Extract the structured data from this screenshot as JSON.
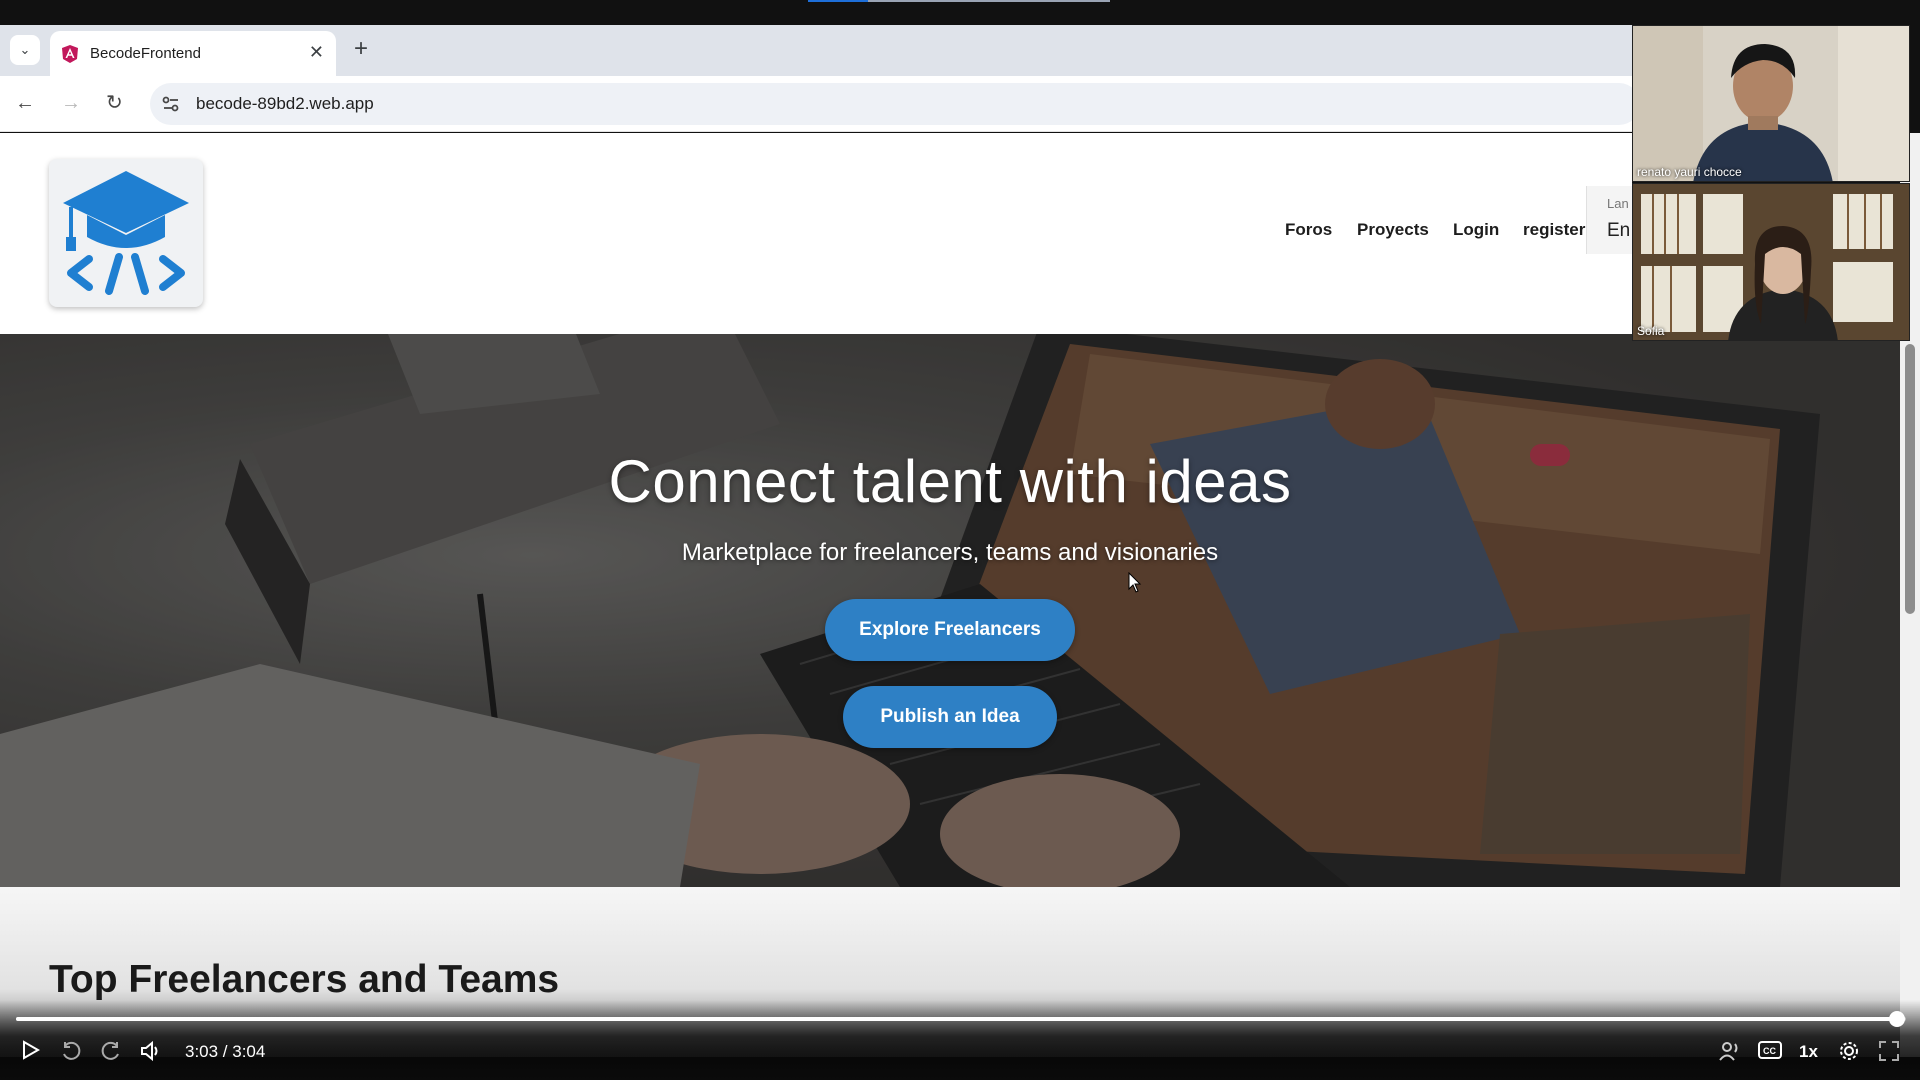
{
  "browser": {
    "tab_title": "BecodeFrontend",
    "url": "becode-89bd2.web.app"
  },
  "site": {
    "nav": {
      "foros": "Foros",
      "proyects": "Proyects",
      "login": "Login",
      "register": "register"
    },
    "language": {
      "label": "Lan",
      "value": "En"
    },
    "hero": {
      "title": "Connect talent with ideas",
      "subtitle": "Marketplace for freelancers, teams and visionaries",
      "explore_button": "Explore Freelancers",
      "publish_button": "Publish an Idea"
    },
    "section": {
      "title": "Top Freelancers and Teams"
    },
    "colors": {
      "brand_blue": "#2e80c5",
      "logo_blue": "#1f7fd1"
    }
  },
  "participants": [
    {
      "name": "renato yauri chocce"
    },
    {
      "name": "Sofia"
    }
  ],
  "player": {
    "time": "3:03 / 3:04",
    "speed": "1x",
    "progress": 0.995
  }
}
